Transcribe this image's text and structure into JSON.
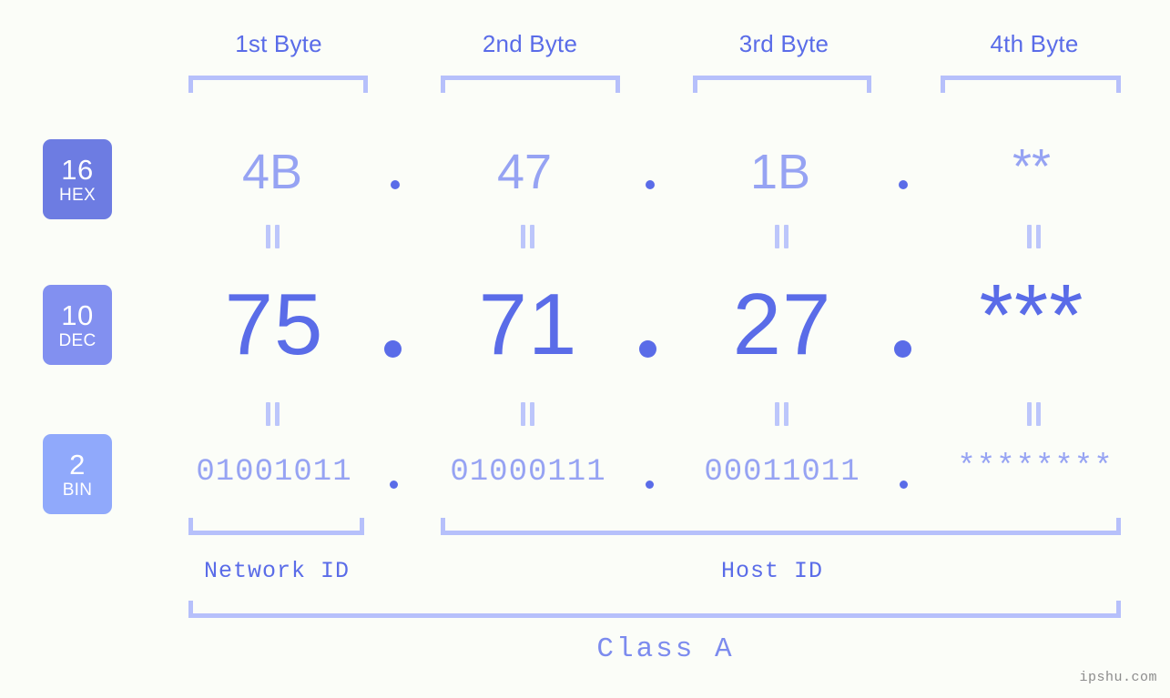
{
  "headers": [
    {
      "label": "1st Byte"
    },
    {
      "label": "2nd Byte"
    },
    {
      "label": "3rd Byte"
    },
    {
      "label": "4th Byte"
    }
  ],
  "radix_badges": [
    {
      "number": "16",
      "name": "HEX",
      "color": "#6d7ce2"
    },
    {
      "number": "10",
      "name": "DEC",
      "color": "#8290f0"
    },
    {
      "number": "2",
      "name": "BIN",
      "color": "#90a9fb"
    }
  ],
  "rows": {
    "hex": {
      "values": [
        "4B",
        "47",
        "1B",
        "**"
      ],
      "separator": "."
    },
    "dec": {
      "values": [
        "75",
        "71",
        "27",
        "***"
      ],
      "separator": "."
    },
    "bin": {
      "values": [
        "01001011",
        "01000111",
        "00011011",
        "********"
      ],
      "separator": "."
    }
  },
  "equality_mark": "=",
  "footer": {
    "network_id": "Network ID",
    "host_id": "Host ID",
    "class": "Class A"
  },
  "watermark": "ipshu.com",
  "colors": {
    "background": "#fbfdf8",
    "accent_strong": "#5a6ce8",
    "accent_light": "#96a3f3",
    "bracket": "#b6c0fb",
    "equality": "#bcc6fb",
    "watermark": "#8c8c8c"
  }
}
